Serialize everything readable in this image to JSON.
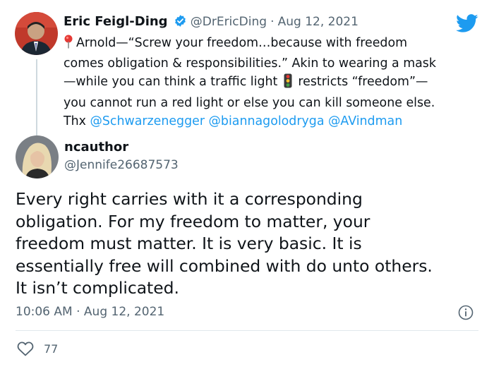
{
  "quoted_tweet": {
    "author_name": "Eric Feigl-Ding",
    "handle": "@DrEricDing",
    "separator": "·",
    "date": "Aug 12, 2021",
    "line1_text": "Arnold—“Screw your freedom…because with freedom",
    "line2_text": "comes obligation & responsibilities.” Akin to wearing a mask",
    "line3_before": "—while you can think a traffic light",
    "line3_after": "restricts “freedom”—",
    "line4_text": "you cannot run a red light or else you can kill someone else.",
    "line5_prefix": "Thx",
    "mentions": [
      "@Schwarzenegger",
      "@biannagolodryga",
      "@AVindman"
    ]
  },
  "reply_tweet": {
    "author_name": "ncauthor",
    "handle": "@Jennife26687573",
    "text_lines": [
      "Every right carries with it a corresponding",
      "obligation. For my freedom to matter, your",
      "freedom must matter. It is very basic. It is",
      "essentially free will combined with do unto others.",
      "It isn’t complicated."
    ],
    "time": "10:06 AM",
    "separator": "·",
    "date": "Aug 12, 2021",
    "like_count": "77"
  },
  "icons": {
    "brand": "twitter-bird-icon",
    "verified": "verified-badge-icon",
    "pin": "round-pushpin-icon",
    "traffic": "vertical-traffic-light-icon",
    "info": "info-icon",
    "like": "heart-outline-icon"
  },
  "colors": {
    "accent": "#1d9bf0",
    "secondary_text": "#536471",
    "divider": "#e1e8ed",
    "verified": "#1d9bf0"
  }
}
